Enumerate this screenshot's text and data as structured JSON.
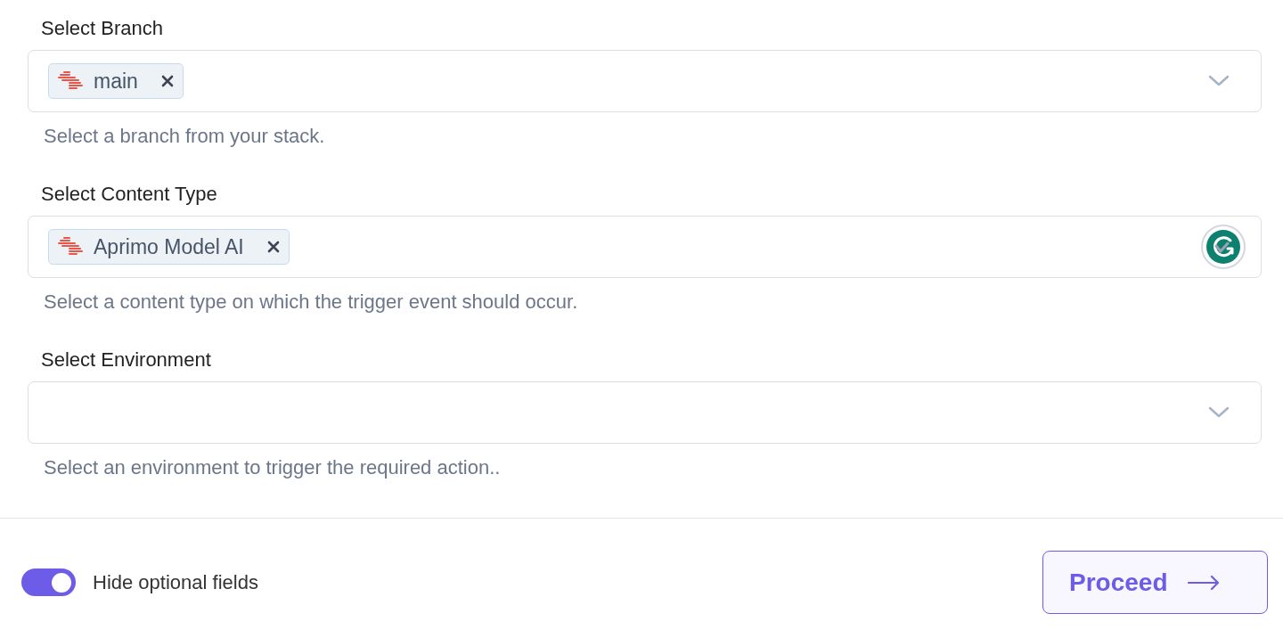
{
  "fields": [
    {
      "label": "Select Branch",
      "selected_items": [
        {
          "label": "main"
        }
      ],
      "overlay_badge": false,
      "helper": "Select a branch from your stack."
    },
    {
      "label": "Select Content Type",
      "selected_items": [
        {
          "label": "Aprimo Model AI"
        }
      ],
      "overlay_badge": true,
      "helper": "Select a content type on which the trigger event should occur."
    },
    {
      "label": "Select Environment",
      "overlay_badge": false,
      "helper": "Select an environment to trigger the required action.."
    }
  ],
  "footer": {
    "toggle": {
      "label": "Hide optional fields",
      "on": true
    },
    "proceed_button": {
      "label": "Proceed"
    }
  }
}
